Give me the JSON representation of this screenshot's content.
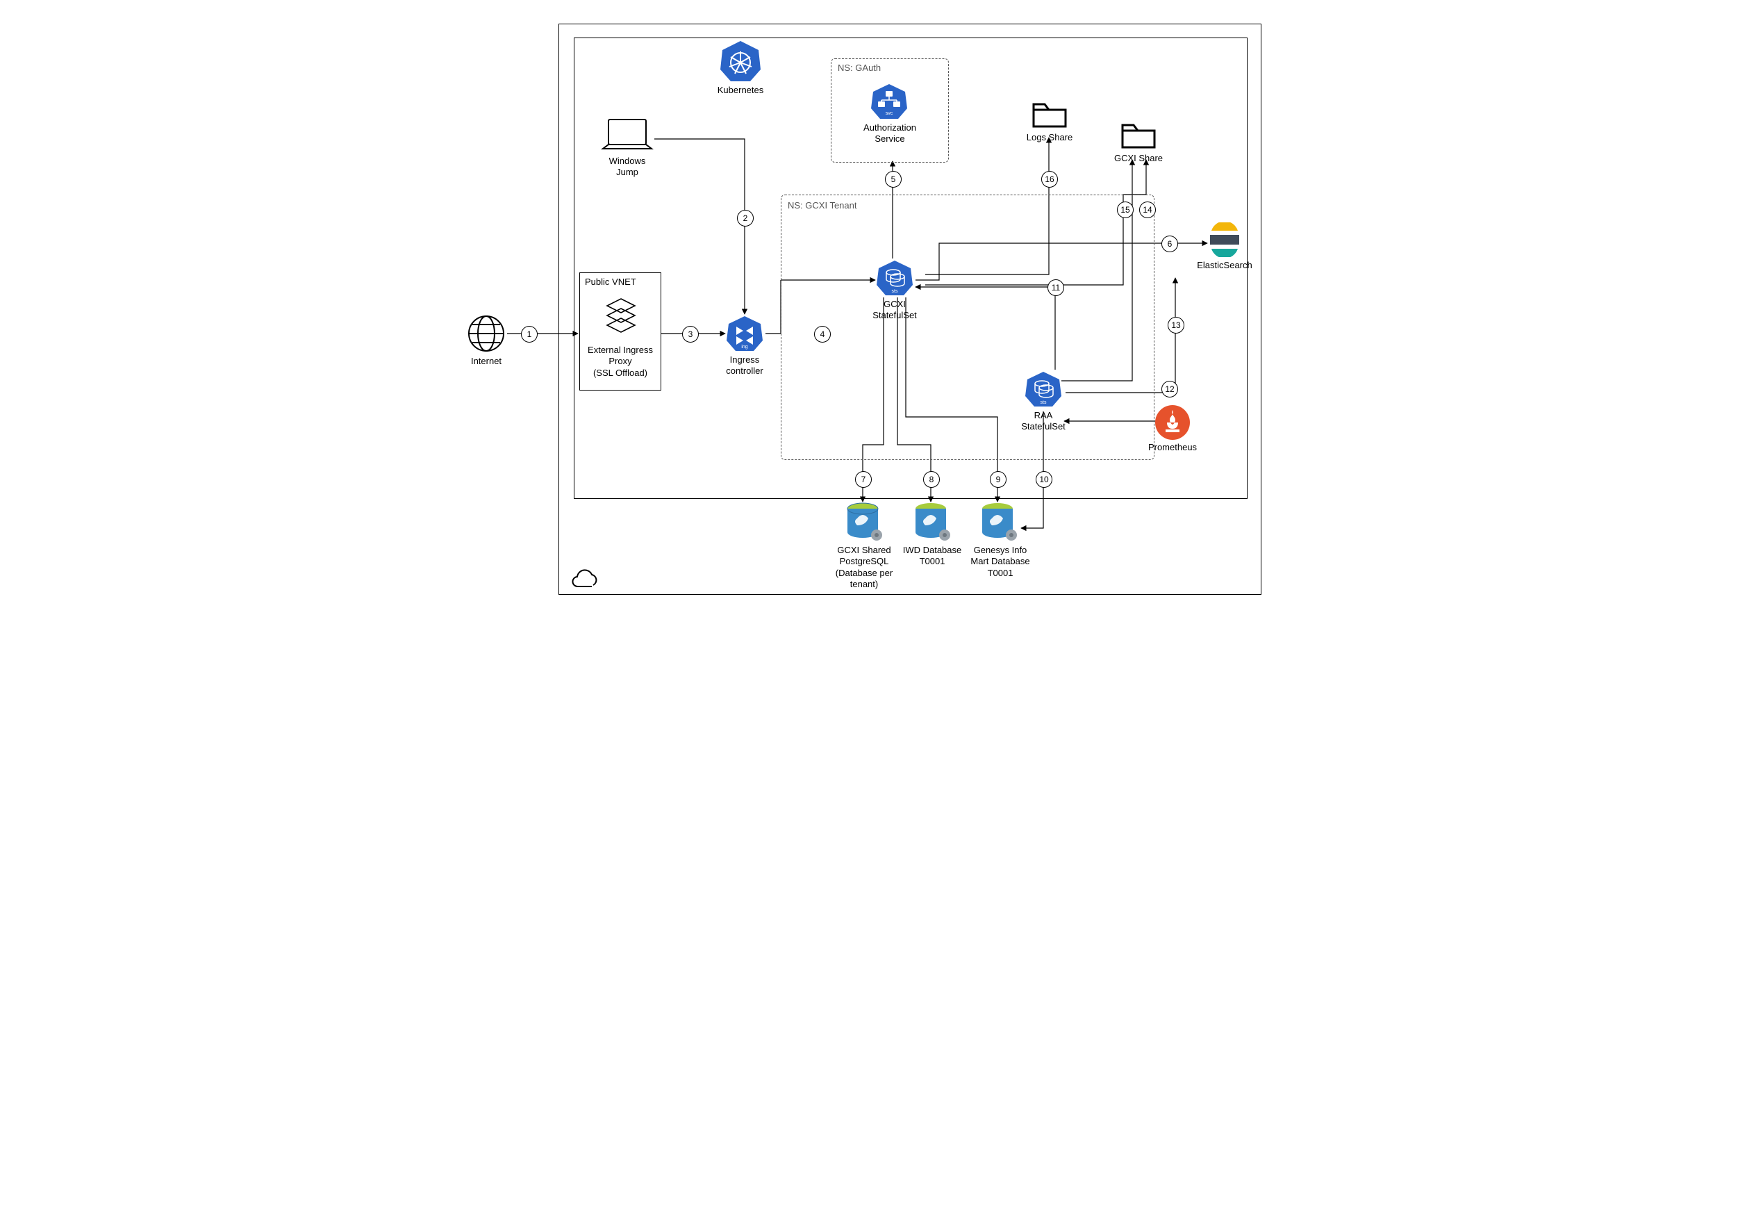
{
  "nodes": {
    "internet": "Internet",
    "publicVnetTitle": "Public VNET",
    "externalIngress1": "External Ingress",
    "externalIngress2": "Proxy",
    "externalIngress3": "(SSL Offload)",
    "windowsJump1": "Windows",
    "windowsJump2": "Jump",
    "kubernetes": "Kubernetes",
    "ingress1": "Ingress",
    "ingress2": "controller",
    "nsGauth": "NS: GAuth",
    "auth1": "Authorization",
    "auth2": "Service",
    "nsGcxi": "NS: GCXI Tenant",
    "gcxiSts1": "GCXI",
    "gcxiSts2": "StatefulSet",
    "raaSts1": "RAA",
    "raaSts2": "StatefulSet",
    "logsShare": "Logs Share",
    "gcxiShare": "GCXI Share",
    "elastic": "ElasticSearch",
    "prometheus": "Prometheus",
    "db1a": "GCXI Shared",
    "db1b": "PostgreSQL",
    "db1c": "(Database per",
    "db1d": "tenant)",
    "db2a": "IWD Database",
    "db2b": "T0001",
    "db3a": "Genesys Info",
    "db3b": "Mart Database",
    "db3c": "T0001"
  },
  "steps": {
    "s1": "1",
    "s2": "2",
    "s3": "3",
    "s4": "4",
    "s5": "5",
    "s6": "6",
    "s7": "7",
    "s8": "8",
    "s9": "9",
    "s10": "10",
    "s11": "11",
    "s12": "12",
    "s13": "13",
    "s14": "14",
    "s15": "15",
    "s16": "16"
  }
}
